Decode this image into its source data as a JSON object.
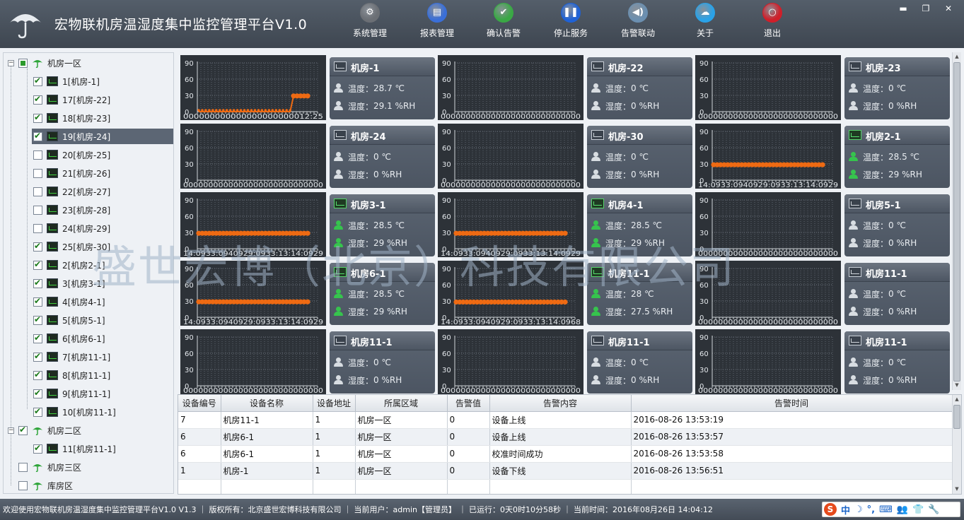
{
  "header": {
    "title": "宏物联机房温湿度集中监控管理平台V1.0",
    "tools": [
      {
        "label": "系统管理",
        "icon": "gear-icon",
        "color": "#6b6f75"
      },
      {
        "label": "报表管理",
        "icon": "report-icon",
        "color": "#3a6fd8"
      },
      {
        "label": "确认告警",
        "icon": "check-icon",
        "color": "#3aa845"
      },
      {
        "label": "停止服务",
        "icon": "pause-icon",
        "color": "#1f62d6"
      },
      {
        "label": "告警联动",
        "icon": "speaker-icon",
        "color": "#6b8fb0"
      },
      {
        "label": "关于",
        "icon": "cloud-icon",
        "color": "#2aa2e8"
      },
      {
        "label": "退出",
        "icon": "power-icon",
        "color": "#d01f2a"
      }
    ]
  },
  "tree": [
    {
      "label": "机房一区",
      "level": 0,
      "check": "partial",
      "type": "zone",
      "expander": "−"
    },
    {
      "label": "1[机房-1]",
      "level": 1,
      "check": "on",
      "type": "device"
    },
    {
      "label": "17[机房-22]",
      "level": 1,
      "check": "on",
      "type": "device"
    },
    {
      "label": "18[机房-23]",
      "level": 1,
      "check": "on",
      "type": "device"
    },
    {
      "label": "19[机房-24]",
      "level": 1,
      "check": "on",
      "type": "device",
      "selected": true
    },
    {
      "label": "20[机房-25]",
      "level": 1,
      "check": "off",
      "type": "device"
    },
    {
      "label": "21[机房-26]",
      "level": 1,
      "check": "off",
      "type": "device"
    },
    {
      "label": "22[机房-27]",
      "level": 1,
      "check": "off",
      "type": "device"
    },
    {
      "label": "23[机房-28]",
      "level": 1,
      "check": "off",
      "type": "device"
    },
    {
      "label": "24[机房-29]",
      "level": 1,
      "check": "off",
      "type": "device"
    },
    {
      "label": "25[机房-30]",
      "level": 1,
      "check": "on",
      "type": "device"
    },
    {
      "label": "2[机房2-1]",
      "level": 1,
      "check": "on",
      "type": "device"
    },
    {
      "label": "3[机房3-1]",
      "level": 1,
      "check": "on",
      "type": "device"
    },
    {
      "label": "4[机房4-1]",
      "level": 1,
      "check": "on",
      "type": "device"
    },
    {
      "label": "5[机房5-1]",
      "level": 1,
      "check": "on",
      "type": "device"
    },
    {
      "label": "6[机房6-1]",
      "level": 1,
      "check": "on",
      "type": "device"
    },
    {
      "label": "7[机房11-1]",
      "level": 1,
      "check": "on",
      "type": "device"
    },
    {
      "label": "8[机房11-1]",
      "level": 1,
      "check": "on",
      "type": "device"
    },
    {
      "label": "9[机房11-1]",
      "level": 1,
      "check": "on",
      "type": "device"
    },
    {
      "label": "10[机房11-1]",
      "level": 1,
      "check": "on",
      "type": "device"
    },
    {
      "label": "机房二区",
      "level": 0,
      "check": "on",
      "type": "zone",
      "expander": "−"
    },
    {
      "label": "11[机房11-1]",
      "level": 1,
      "check": "on",
      "type": "device"
    },
    {
      "label": "机房三区",
      "level": 0,
      "check": "off",
      "type": "zone"
    },
    {
      "label": "库房区",
      "level": 0,
      "check": "off",
      "type": "zone"
    }
  ],
  "chart_axis": {
    "ticks": [
      "90",
      "60",
      "30",
      "0"
    ]
  },
  "temp_prefix": "温度：",
  "humi_prefix": "湿度：",
  "monitors": [
    {
      "name": "机房-1",
      "live": false,
      "temp": "28.7 ℃",
      "humi": "29.1 %RH",
      "xlabel": "000000000000000000000012:25",
      "series": {
        "type": "jump",
        "value": 29
      }
    },
    {
      "name": "机房-22",
      "live": false,
      "temp": "0 ℃",
      "humi": "0 %RH",
      "xlabel": "0000000000000000000000000000",
      "series": null
    },
    {
      "name": "机房-23",
      "live": false,
      "temp": "0 ℃",
      "humi": "0 %RH",
      "xlabel": "0000000000000000000000000000",
      "series": null
    },
    {
      "name": "机房-24",
      "live": false,
      "temp": "0 ℃",
      "humi": "0 %RH",
      "xlabel": "0000000000000000000000000000",
      "series": null
    },
    {
      "name": "机房-30",
      "live": false,
      "temp": "0 ℃",
      "humi": "0 %RH",
      "xlabel": "0000000000000000000000000000",
      "series": null
    },
    {
      "name": "机房2-1",
      "live": true,
      "temp": "28.5 ℃",
      "humi": "29 %RH",
      "xlabel": "14:0933:0940929:0933:13:14:0929",
      "series": {
        "type": "flat",
        "value": 28.5
      }
    },
    {
      "name": "机房3-1",
      "live": true,
      "temp": "28.5 ℃",
      "humi": "29 %RH",
      "xlabel": "14:0933:0940929:0933:13:14:0929",
      "series": {
        "type": "flat",
        "value": 28.5
      }
    },
    {
      "name": "机房4-1",
      "live": true,
      "temp": "28.5 ℃",
      "humi": "29 %RH",
      "xlabel": "14:0933:0940929:0933:13:14:0929",
      "series": {
        "type": "flat",
        "value": 28.5
      }
    },
    {
      "name": "机房5-1",
      "live": false,
      "temp": "0 ℃",
      "humi": "0 %RH",
      "xlabel": "0000000000000000000000000000",
      "series": null
    },
    {
      "name": "机房6-1",
      "live": true,
      "temp": "28.5 ℃",
      "humi": "29 %RH",
      "xlabel": "14:0933:0940929:0933:13:14:0929",
      "series": {
        "type": "flat",
        "value": 28.5
      }
    },
    {
      "name": "机房11-1",
      "live": true,
      "temp": "28 ℃",
      "humi": "27.5 %RH",
      "xlabel": "14:0933:0940929:0933:13:14:0968",
      "series": {
        "type": "flat",
        "value": 28
      }
    },
    {
      "name": "机房11-1",
      "live": false,
      "temp": "0 ℃",
      "humi": "0 %RH",
      "xlabel": "0000000000000000000000000000",
      "series": null
    },
    {
      "name": "机房11-1",
      "live": false,
      "temp": "0 ℃",
      "humi": "0 %RH",
      "xlabel": "0000000000000000000000000000",
      "series": null
    },
    {
      "name": "机房11-1",
      "live": false,
      "temp": "0 ℃",
      "humi": "0 %RH",
      "xlabel": "0000000000000000000000000000",
      "series": null
    },
    {
      "name": "机房11-1",
      "live": false,
      "temp": "0 ℃",
      "humi": "0 %RH",
      "xlabel": "0000000000000000000000000000",
      "series": null
    }
  ],
  "chart_data": {
    "type": "line",
    "ylim": [
      0,
      90
    ],
    "yticks": [
      90,
      60,
      30,
      0
    ],
    "series_color": "#ee6a13",
    "charts": [
      {
        "panel": "机房-1",
        "series": [
          {
            "values": [
              0,
              0,
              0,
              0,
              0,
              0,
              0,
              0,
              0,
              0,
              0,
              0,
              0,
              0,
              0,
              0,
              0,
              0,
              0,
              0,
              0,
              0,
              0,
              0,
              0,
              0,
              0,
              29,
              29,
              29,
              29,
              29
            ]
          }
        ]
      },
      {
        "panel": "机房2-1",
        "series": [
          {
            "values": [
              28.5,
              28.5,
              28.5,
              28.5,
              28.5,
              28.5,
              28.5,
              28.5,
              28.5,
              28.5,
              28.5,
              28.5,
              28.5,
              28.5,
              28.5,
              28.5,
              28.5,
              28.5,
              28.5,
              28.5,
              28.5,
              28.5,
              28.5,
              28.5,
              28.5,
              28.5,
              28.5,
              28.5,
              28.5,
              28.5,
              28.5,
              28.5
            ]
          }
        ]
      },
      {
        "panel": "机房3-1",
        "series": [
          {
            "values": [
              28.5,
              28.5,
              28.5,
              28.5,
              28.5,
              28.5,
              28.5,
              28.5,
              28.5,
              28.5,
              28.5,
              28.5,
              28.5,
              28.5,
              28.5,
              28.5,
              28.5,
              28.5,
              28.5,
              28.5,
              28.5,
              28.5,
              28.5,
              28.5,
              28.5,
              28.5,
              28.5,
              28.5,
              28.5,
              28.5,
              28.5,
              28.5
            ]
          }
        ]
      },
      {
        "panel": "机房4-1",
        "series": [
          {
            "values": [
              28.5,
              28.5,
              28.5,
              28.5,
              28.5,
              28.5,
              28.5,
              28.5,
              28.5,
              28.5,
              28.5,
              28.5,
              28.5,
              28.5,
              28.5,
              28.5,
              28.5,
              28.5,
              28.5,
              28.5,
              28.5,
              28.5,
              28.5,
              28.5,
              28.5,
              28.5,
              28.5,
              28.5,
              28.5,
              28.5,
              28.5,
              28.5
            ]
          }
        ]
      },
      {
        "panel": "机房6-1",
        "series": [
          {
            "values": [
              28.5,
              28.5,
              28.5,
              28.5,
              28.5,
              28.5,
              28.5,
              28.5,
              28.5,
              28.5,
              28.5,
              28.5,
              28.5,
              28.5,
              28.5,
              28.5,
              28.5,
              28.5,
              28.5,
              28.5,
              28.5,
              28.5,
              28.5,
              28.5,
              28.5,
              28.5,
              28.5,
              28.5,
              28.5,
              28.5,
              28.5,
              28.5
            ]
          }
        ]
      },
      {
        "panel": "机房11-1",
        "series": [
          {
            "values": [
              28,
              28,
              28,
              28,
              28,
              28,
              28,
              28,
              28,
              28,
              28,
              28,
              28,
              28,
              28,
              28,
              28,
              28,
              28,
              28,
              28,
              28,
              28,
              28,
              28,
              28,
              28,
              28,
              28,
              28,
              28,
              28
            ]
          }
        ]
      }
    ]
  },
  "watermark": "盛世宏博（北京）科技有限公司",
  "alarm_table": {
    "columns": [
      "设备编号",
      "设备名称",
      "设备地址",
      "所属区域",
      "告警值",
      "告警内容",
      "告警时间"
    ],
    "rows": [
      [
        "7",
        "机房11-1",
        "1",
        "机房一区",
        "0",
        "设备上线",
        "2016-08-26 13:53:19"
      ],
      [
        "6",
        "机房6-1",
        "1",
        "机房一区",
        "0",
        "设备上线",
        "2016-08-26 13:53:57"
      ],
      [
        "6",
        "机房6-1",
        "1",
        "机房一区",
        "0",
        "校准时间成功",
        "2016-08-26 13:53:58"
      ],
      [
        "1",
        "机房-1",
        "1",
        "机房一区",
        "0",
        "设备下线",
        "2016-08-26 13:56:51"
      ],
      [
        "",
        "",
        "",
        "",
        "",
        "",
        ""
      ]
    ]
  },
  "status": {
    "text": "欢迎使用宏物联机房温湿度集中监控管理平台V1.0 V1.3 ｜ 版权所有：北京盛世宏博科技有限公司 ｜ 当前用户：admin【管理员】 ｜ 已运行：0天0时10分58秒 ｜ 当前时间：2016年08月26日 14:04:12",
    "ime": [
      "中",
      "☽",
      "°,",
      "⌨",
      "👥",
      "👕",
      "🔧"
    ]
  }
}
